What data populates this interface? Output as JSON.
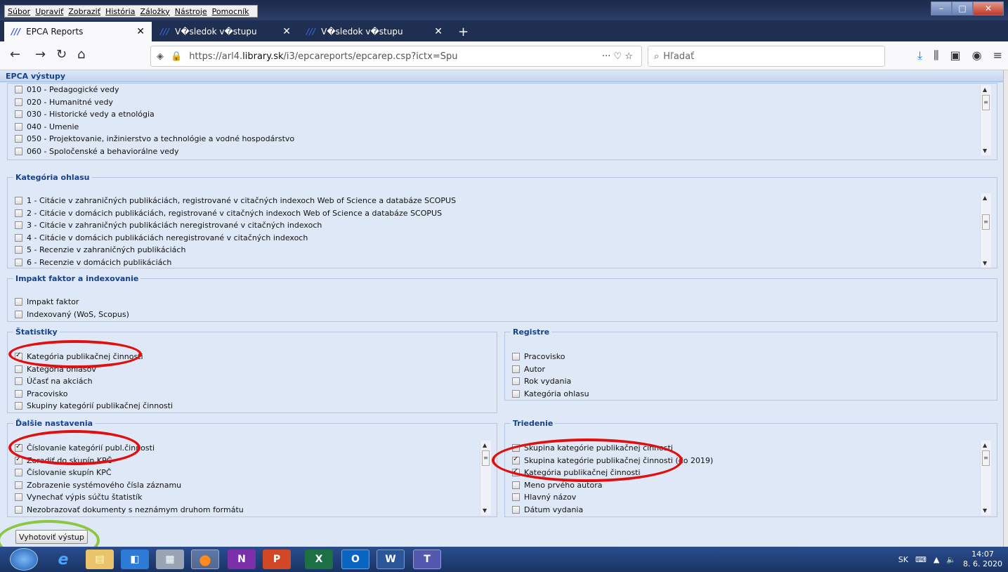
{
  "menubar": {
    "items": [
      "Súbor",
      "Upraviť",
      "Zobraziť",
      "História",
      "Záložky",
      "Nástroje",
      "Pomocník"
    ]
  },
  "tabs": [
    {
      "title": "EPCA Reports",
      "active": true
    },
    {
      "title": "V�sledok v�stupu",
      "active": false
    },
    {
      "title": "V�sledok v�stupu",
      "active": false
    }
  ],
  "toolbar": {
    "url_prefix": "https://arl4.",
    "url_domain": "library.sk",
    "url_path": "/i3/epcareports/epcarep.csp?ictx=Spu",
    "search_placeholder": "Hľadať"
  },
  "panel": {
    "title": "EPCA výstupy"
  },
  "fields": [
    {
      "legend": "",
      "items": [
        {
          "label": "010 - Pedagogické vedy",
          "checked": false
        },
        {
          "label": "020 - Humanitné vedy",
          "checked": false
        },
        {
          "label": "030 - Historické vedy a etnológia",
          "checked": false
        },
        {
          "label": "040 - Umenie",
          "checked": false
        },
        {
          "label": "050 - Projektovanie, inžinierstvo a technológie a vodné hospodárstvo",
          "checked": false
        },
        {
          "label": "060 - Spoločenské a behaviorálne vedy",
          "checked": false
        }
      ]
    },
    {
      "legend": "Kategória ohlasu",
      "items": [
        {
          "label": "1 - Citácie v zahraničných publikáciách, registrované v citačných indexoch Web of Science a databáze SCOPUS",
          "checked": false
        },
        {
          "label": "2 - Citácie v domácich publikáciách, registrované v citačných indexoch Web of Science a databáze SCOPUS",
          "checked": false
        },
        {
          "label": "3 - Citácie v zahraničných publikáciách neregistrované v citačných indexoch",
          "checked": false
        },
        {
          "label": "4 - Citácie v domácich publikáciách neregistrované v citačných indexoch",
          "checked": false
        },
        {
          "label": "5 - Recenzie v zahraničných publikáciách",
          "checked": false
        },
        {
          "label": "6 - Recenzie v domácich publikáciách",
          "checked": false
        }
      ]
    },
    {
      "legend": "Impakt faktor a indexovanie",
      "items": [
        {
          "label": "Impakt faktor",
          "checked": false
        },
        {
          "label": "Indexovaný (WoS, Scopus)",
          "checked": false
        }
      ]
    },
    {
      "legend": "Štatistiky",
      "items": [
        {
          "label": "Kategória publikačnej činnosti",
          "checked": true
        },
        {
          "label": "Kategória ohlasov",
          "checked": false
        },
        {
          "label": "Účasť na akciách",
          "checked": false
        },
        {
          "label": "Pracovisko",
          "checked": false
        },
        {
          "label": "Skupiny kategórií publikačnej činnosti",
          "checked": false
        }
      ]
    },
    {
      "legend": "Registre",
      "items": [
        {
          "label": "Pracovisko",
          "checked": false
        },
        {
          "label": "Autor",
          "checked": false
        },
        {
          "label": "Rok vydania",
          "checked": false
        },
        {
          "label": "Kategória ohlasu",
          "checked": false
        }
      ]
    },
    {
      "legend": "Ďalšie nastavenia",
      "items": [
        {
          "label": "Číslovanie kategórií publ.činnosti",
          "checked": true
        },
        {
          "label": "Zoradiť do skupín KPČ",
          "checked": true
        },
        {
          "label": "Číslovanie skupín KPČ",
          "checked": false
        },
        {
          "label": "Zobrazenie systémového čísla záznamu",
          "checked": false
        },
        {
          "label": "Vynechať výpis súčtu štatistík",
          "checked": false
        },
        {
          "label": "Nezobrazovať dokumenty s neznámym druhom formátu",
          "checked": false
        }
      ]
    },
    {
      "legend": "Triedenie",
      "items": [
        {
          "label": "Skupina kategórie publikačnej činnosti",
          "checked": false
        },
        {
          "label": "Skupina kategórie publikačnej činnosti (do 2019)",
          "checked": true
        },
        {
          "label": "Kategória publikačnej činnosti",
          "checked": true
        },
        {
          "label": "Meno prvého autora",
          "checked": false
        },
        {
          "label": "Hlavný názov",
          "checked": false
        },
        {
          "label": "Dátum vydania",
          "checked": false
        }
      ]
    }
  ],
  "submit_label": "Vyhotoviť výstup",
  "taskbar": {
    "icons": [
      "ie-icon",
      "explorer-icon",
      "outlook-express-icon",
      "calculator-icon",
      "firefox-icon",
      "onenote-icon",
      "powerpoint-icon",
      "excel-icon",
      "outlook-icon",
      "word-icon",
      "teams-icon"
    ],
    "lang": "SK",
    "time": "14:07",
    "date": "8. 6. 2020"
  }
}
